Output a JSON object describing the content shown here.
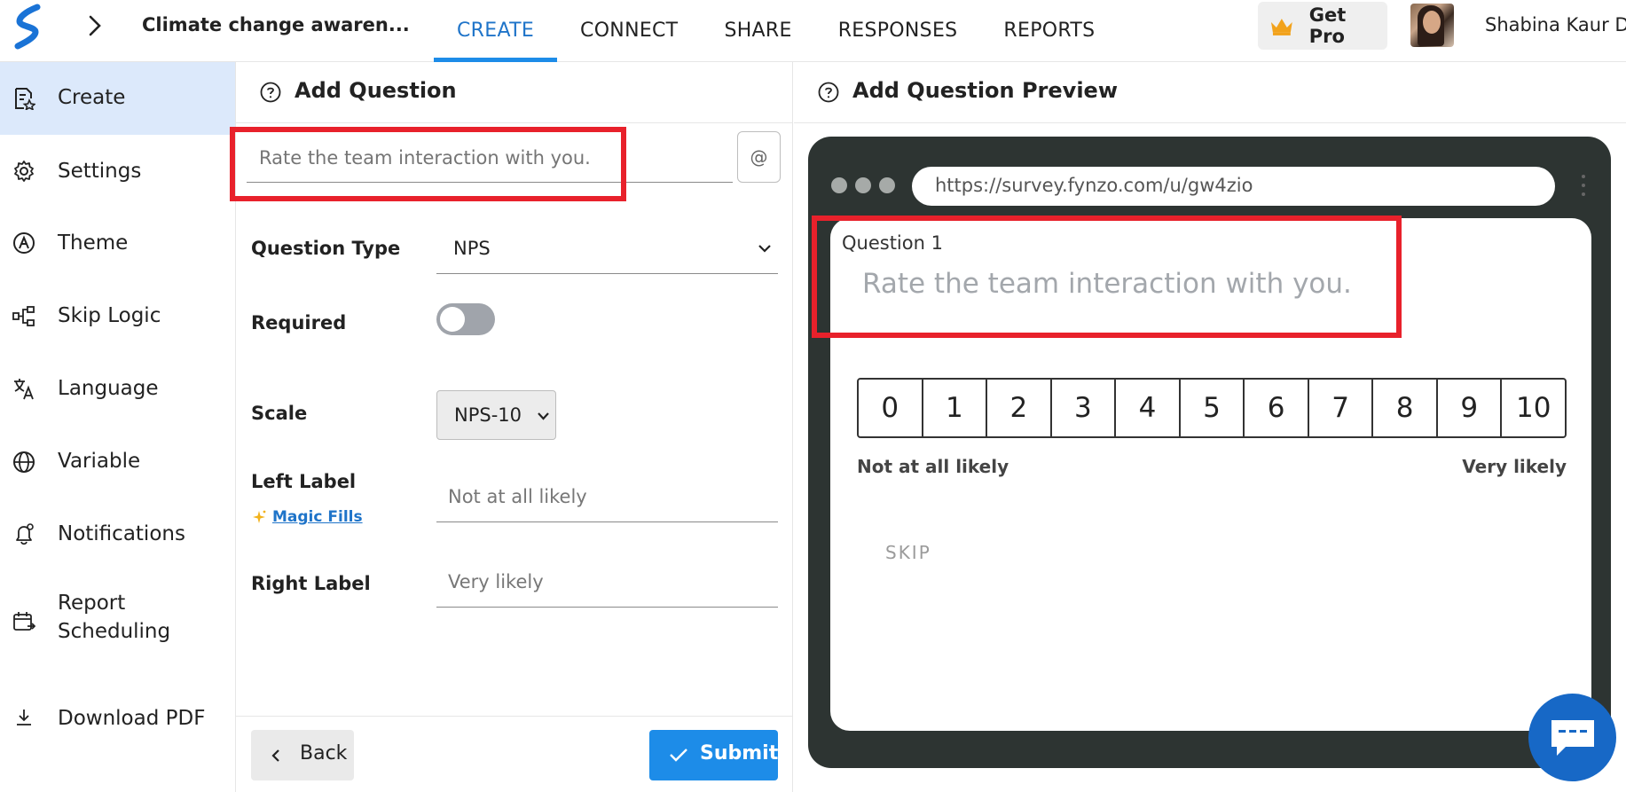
{
  "header": {
    "survey_title": "Climate change awaren...",
    "tabs": [
      {
        "label": "CREATE",
        "active": true
      },
      {
        "label": "CONNECT",
        "active": false
      },
      {
        "label": "SHARE",
        "active": false
      },
      {
        "label": "RESPONSES",
        "active": false
      },
      {
        "label": "REPORTS",
        "active": false
      }
    ],
    "get_pro_label": "Get Pro",
    "user_name": "Shabina Kaur D"
  },
  "sidebar": {
    "items": [
      {
        "label": "Create",
        "icon": "create-icon",
        "active": true
      },
      {
        "label": "Settings",
        "icon": "gear-icon",
        "active": false
      },
      {
        "label": "Theme",
        "icon": "theme-icon",
        "active": false
      },
      {
        "label": "Skip Logic",
        "icon": "skip-logic-icon",
        "active": false
      },
      {
        "label": "Language",
        "icon": "translate-icon",
        "active": false
      },
      {
        "label": "Variable",
        "icon": "globe-icon",
        "active": false
      },
      {
        "label": "Notifications",
        "icon": "bell-icon",
        "active": false
      },
      {
        "label": "Report Scheduling",
        "icon": "calendar-icon",
        "active": false
      },
      {
        "label": "Download PDF",
        "icon": "download-icon",
        "active": false
      }
    ]
  },
  "editor": {
    "title": "Add Question",
    "question_placeholder": "Rate the team interaction with you.",
    "at_button": "@",
    "question_type_label": "Question Type",
    "question_type_value": "NPS",
    "required_label": "Required",
    "required_on": false,
    "scale_label": "Scale",
    "scale_value": "NPS-10",
    "left_label_label": "Left Label",
    "left_label_value": "Not at all likely",
    "magic_fills_label": "Magic Fills",
    "right_label_label": "Right Label",
    "right_label_value": "Very likely",
    "back_label": "Back",
    "submit_label": "Submit"
  },
  "preview": {
    "title": "Add Question Preview",
    "url": "https://survey.fynzo.com/u/gw4zio",
    "question_number": "Question 1",
    "question_text": "Rate the team interaction with you.",
    "scale": [
      "0",
      "1",
      "2",
      "3",
      "4",
      "5",
      "6",
      "7",
      "8",
      "9",
      "10"
    ],
    "left_label": "Not at all likely",
    "right_label": "Very likely",
    "skip_label": "SKIP"
  },
  "colors": {
    "accent": "#1d8ce8",
    "highlight": "#e8212b",
    "sidebar_active": "#dce9fb",
    "browser_frame": "#2d3432"
  }
}
